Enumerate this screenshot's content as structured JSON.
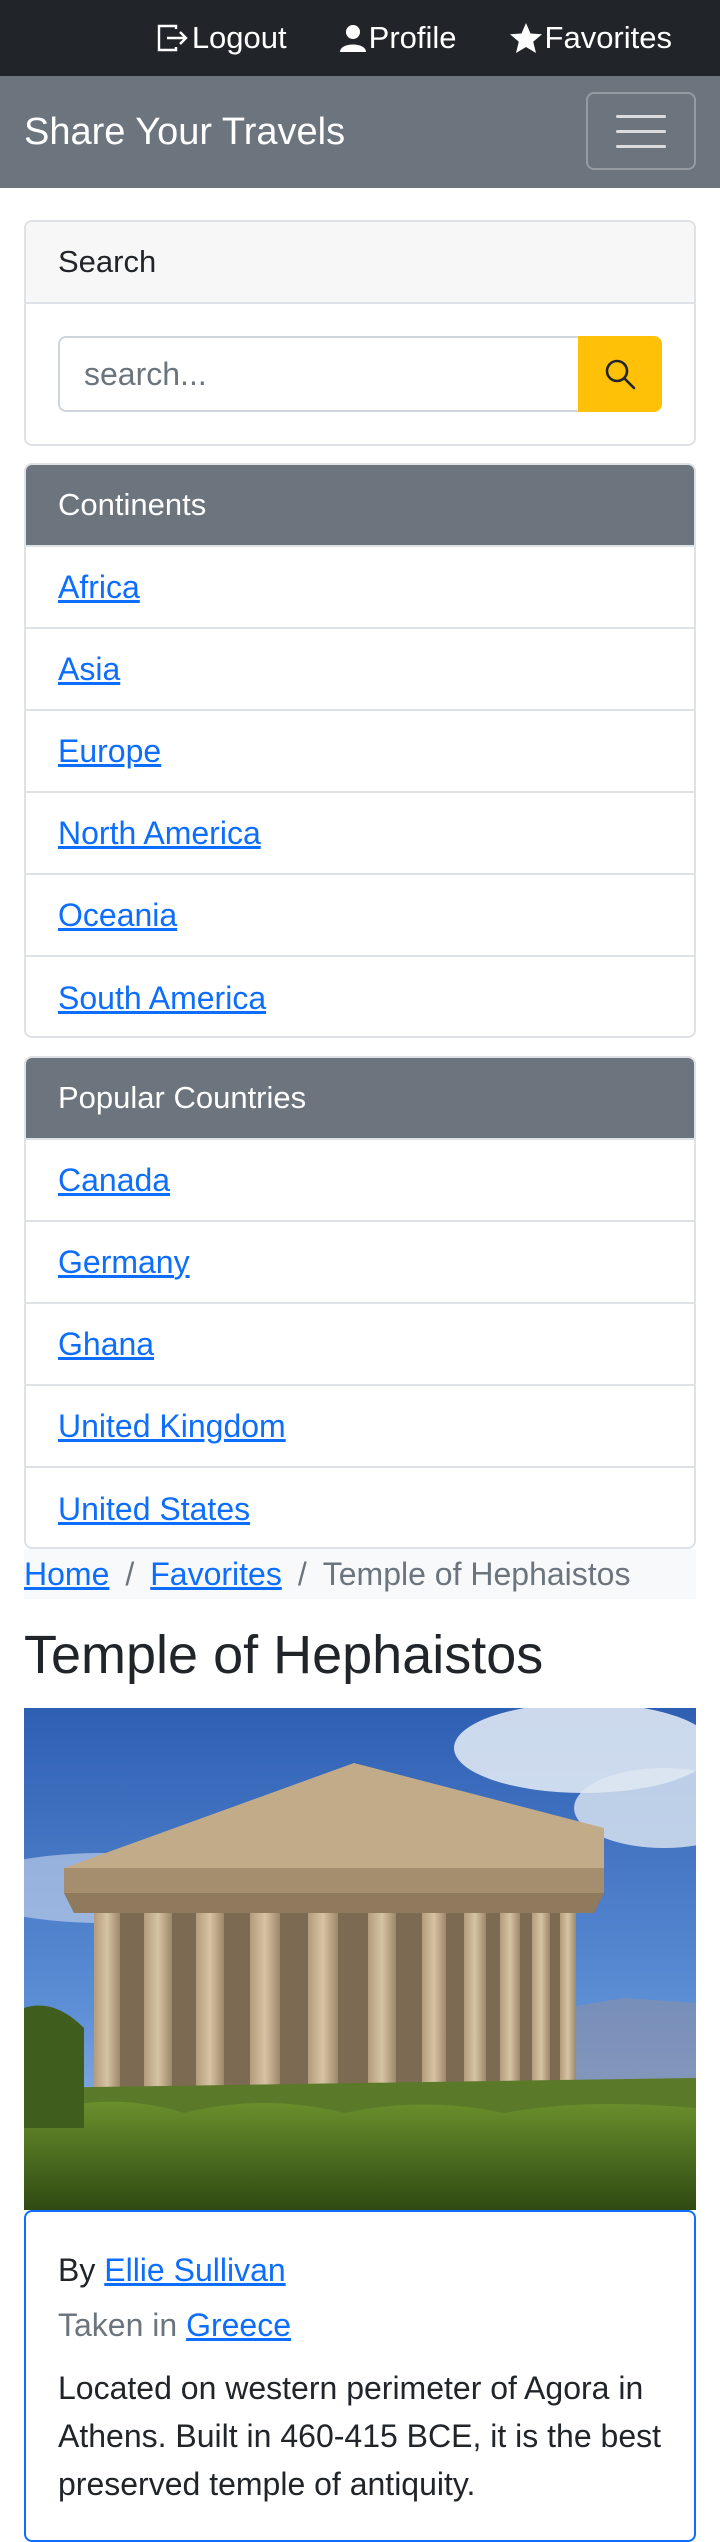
{
  "topbar": {
    "logout": "Logout",
    "profile": "Profile",
    "favorites": "Favorites"
  },
  "navbar": {
    "brand": "Share Your Travels"
  },
  "search": {
    "header": "Search",
    "placeholder": "search..."
  },
  "continents": {
    "header": "Continents",
    "items": [
      "Africa",
      "Asia",
      "Europe",
      "North America",
      "Oceania",
      "South America"
    ]
  },
  "countries": {
    "header": "Popular Countries",
    "items": [
      "Canada",
      "Germany",
      "Ghana",
      "United Kingdom",
      "United States"
    ]
  },
  "breadcrumb": {
    "home": "Home",
    "favorites": "Favorites",
    "current": "Temple of Hephaistos",
    "separator": "/"
  },
  "photo": {
    "title": "Temple of Hephaistos",
    "by_prefix": "By",
    "author": "Ellie Sullivan",
    "taken_prefix": "Taken in",
    "country": "Greece",
    "description": "Located on western perimeter of Agora in Athens. Built in 460-415 BCE, it is the best preserved temple of antiquity."
  },
  "colors": {
    "topbar": "#212529",
    "navbar": "#6c757d",
    "link": "#0d6efd",
    "search_button": "#ffc107"
  },
  "icons": {
    "logout": "logout-icon",
    "profile": "person-icon",
    "favorites": "star-icon",
    "search": "search-icon",
    "menu": "hamburger-icon"
  }
}
